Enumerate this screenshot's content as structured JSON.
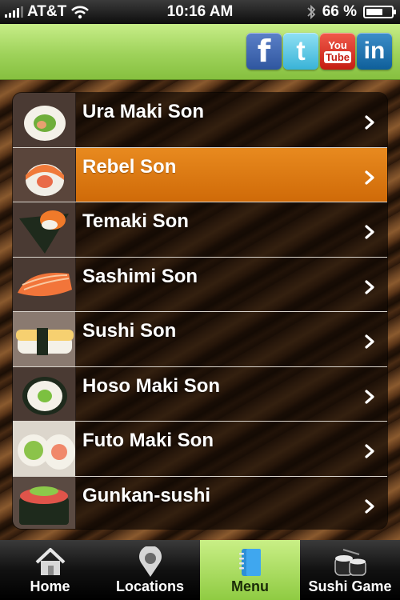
{
  "status_bar": {
    "carrier": "AT&T",
    "time": "10:16 AM",
    "battery": "66 %",
    "battery_level": 0.66
  },
  "social": {
    "facebook": "f",
    "twitter": "t",
    "youtube_top": "You",
    "youtube_bottom": "Tube",
    "linkedin": "in"
  },
  "menu": {
    "items": [
      {
        "label": "Ura Maki Son",
        "selected": false
      },
      {
        "label": "Rebel Son",
        "selected": true
      },
      {
        "label": "Temaki Son",
        "selected": false
      },
      {
        "label": "Sashimi Son",
        "selected": false
      },
      {
        "label": "Sushi Son",
        "selected": false
      },
      {
        "label": "Hoso Maki Son",
        "selected": false
      },
      {
        "label": "Futo Maki Son",
        "selected": false
      },
      {
        "label": "Gunkan-sushi",
        "selected": false
      }
    ]
  },
  "tabbar": {
    "tabs": [
      {
        "label": "Home",
        "icon": "home-icon",
        "active": false
      },
      {
        "label": "Locations",
        "icon": "location-pin-icon",
        "active": false
      },
      {
        "label": "Menu",
        "icon": "notebook-icon",
        "active": true
      },
      {
        "label": "Sushi Game",
        "icon": "sushi-icon",
        "active": false
      }
    ]
  },
  "colors": {
    "header_green": "#9ed25a",
    "selected_orange": "#e07a12",
    "active_tab_green": "#b0e070"
  }
}
